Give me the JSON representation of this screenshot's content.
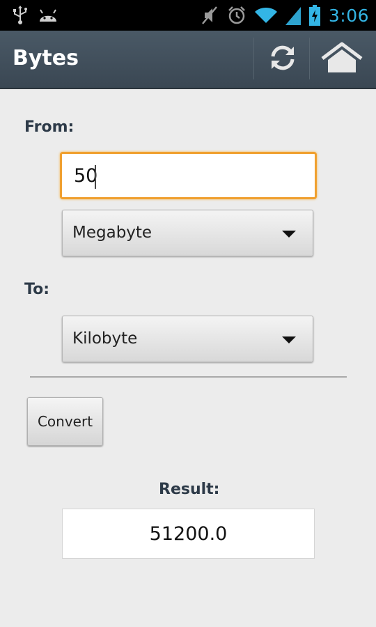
{
  "status_bar": {
    "time": "3:06",
    "icons": [
      "usb-icon",
      "android-icon",
      "mute-icon",
      "alarm-icon",
      "wifi-icon",
      "signal-icon",
      "battery-icon"
    ],
    "color": "#33b5e5"
  },
  "action_bar": {
    "title": "Bytes",
    "actions": [
      "refresh-icon",
      "home-icon"
    ]
  },
  "form": {
    "from_label": "From:",
    "from_value": "50",
    "from_unit": "Megabyte",
    "to_label": "To:",
    "to_unit": "Kilobyte",
    "convert_label": "Convert",
    "result_label": "Result:",
    "result_value": "51200.0"
  },
  "colors": {
    "accent_focus": "#f0a030",
    "action_bar_bg": "#3f4d59",
    "background": "#ececec",
    "label_text": "#2d3a48"
  }
}
